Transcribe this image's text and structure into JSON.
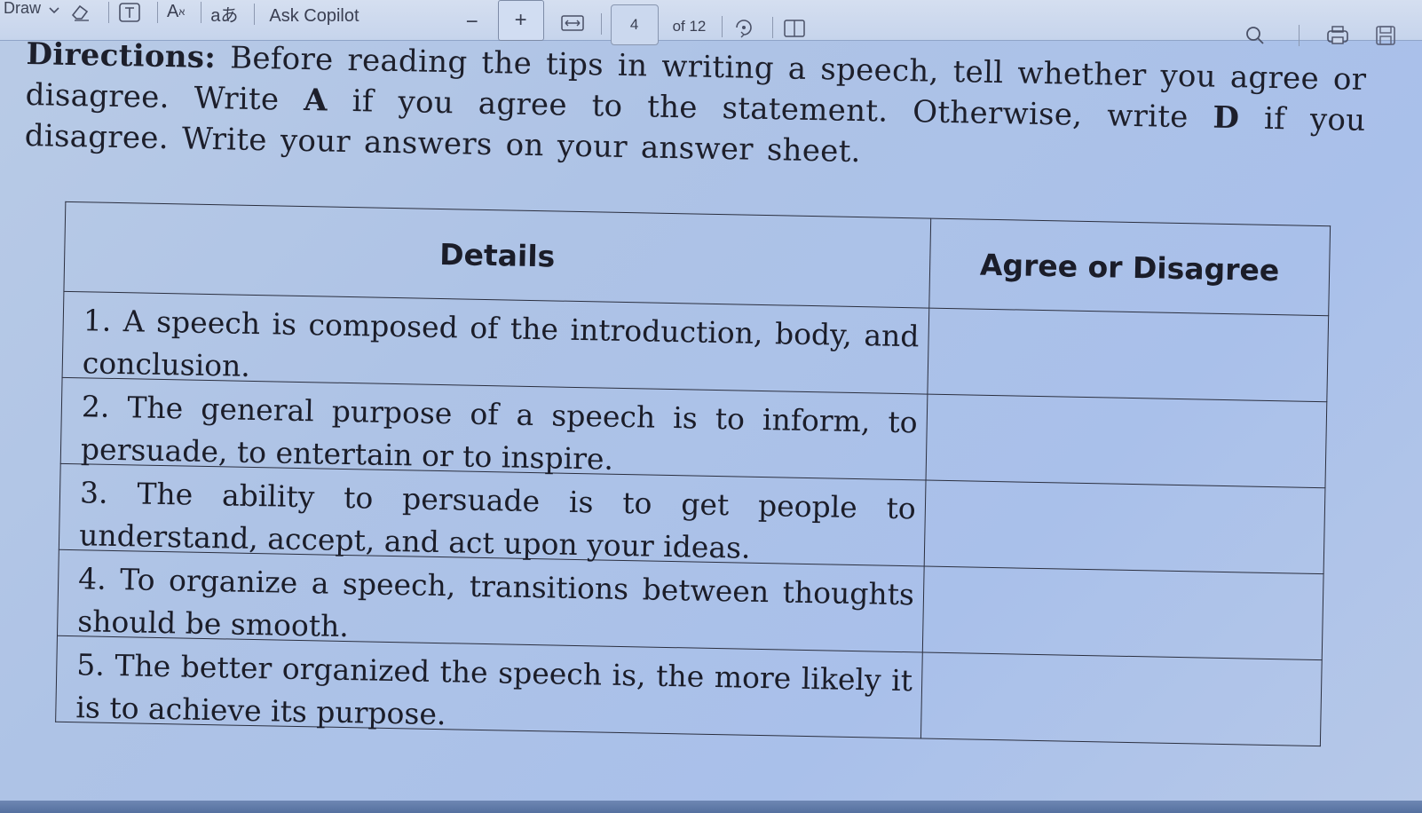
{
  "toolbar": {
    "draw_label": "Draw",
    "ask_copilot_label": "Ask Copilot",
    "zoom_out_symbol": "−",
    "zoom_in_symbol": "+",
    "current_page": "4",
    "page_total": "of 12",
    "icons": [
      "chevron-down-icon",
      "eraser-icon",
      "text-box-icon",
      "text-size-icon",
      "translate-icon",
      "fit-width-icon",
      "rotate-icon",
      "page-view-icon",
      "search-icon",
      "print-icon",
      "save-icon"
    ]
  },
  "document": {
    "directions_lead": "Directions:",
    "directions_text_1": " Before reading the tips in writing a speech, tell whether you agree or disagree. Write ",
    "agree_letter": "A",
    "directions_text_2": " if you agree to the statement. Otherwise, write ",
    "disagree_letter": "D",
    "directions_text_3": " if you disagree. Write your answers on your answer sheet.",
    "table": {
      "headers": [
        "Details",
        "Agree or Disagree"
      ],
      "rows": [
        {
          "detail": "1. A speech is composed of the introduction, body, and conclusion.",
          "answer": ""
        },
        {
          "detail": "2. The general purpose of a speech is to inform, to persuade, to entertain or to inspire.",
          "answer": ""
        },
        {
          "detail": "3. The ability to persuade is to get people to understand, accept, and act upon your ideas.",
          "answer": ""
        },
        {
          "detail": "4. To organize a speech, transitions between thoughts should be smooth.",
          "answer": ""
        },
        {
          "detail": "5. The better organized the speech is, the more likely it is to achieve its purpose.",
          "answer": ""
        }
      ]
    }
  }
}
